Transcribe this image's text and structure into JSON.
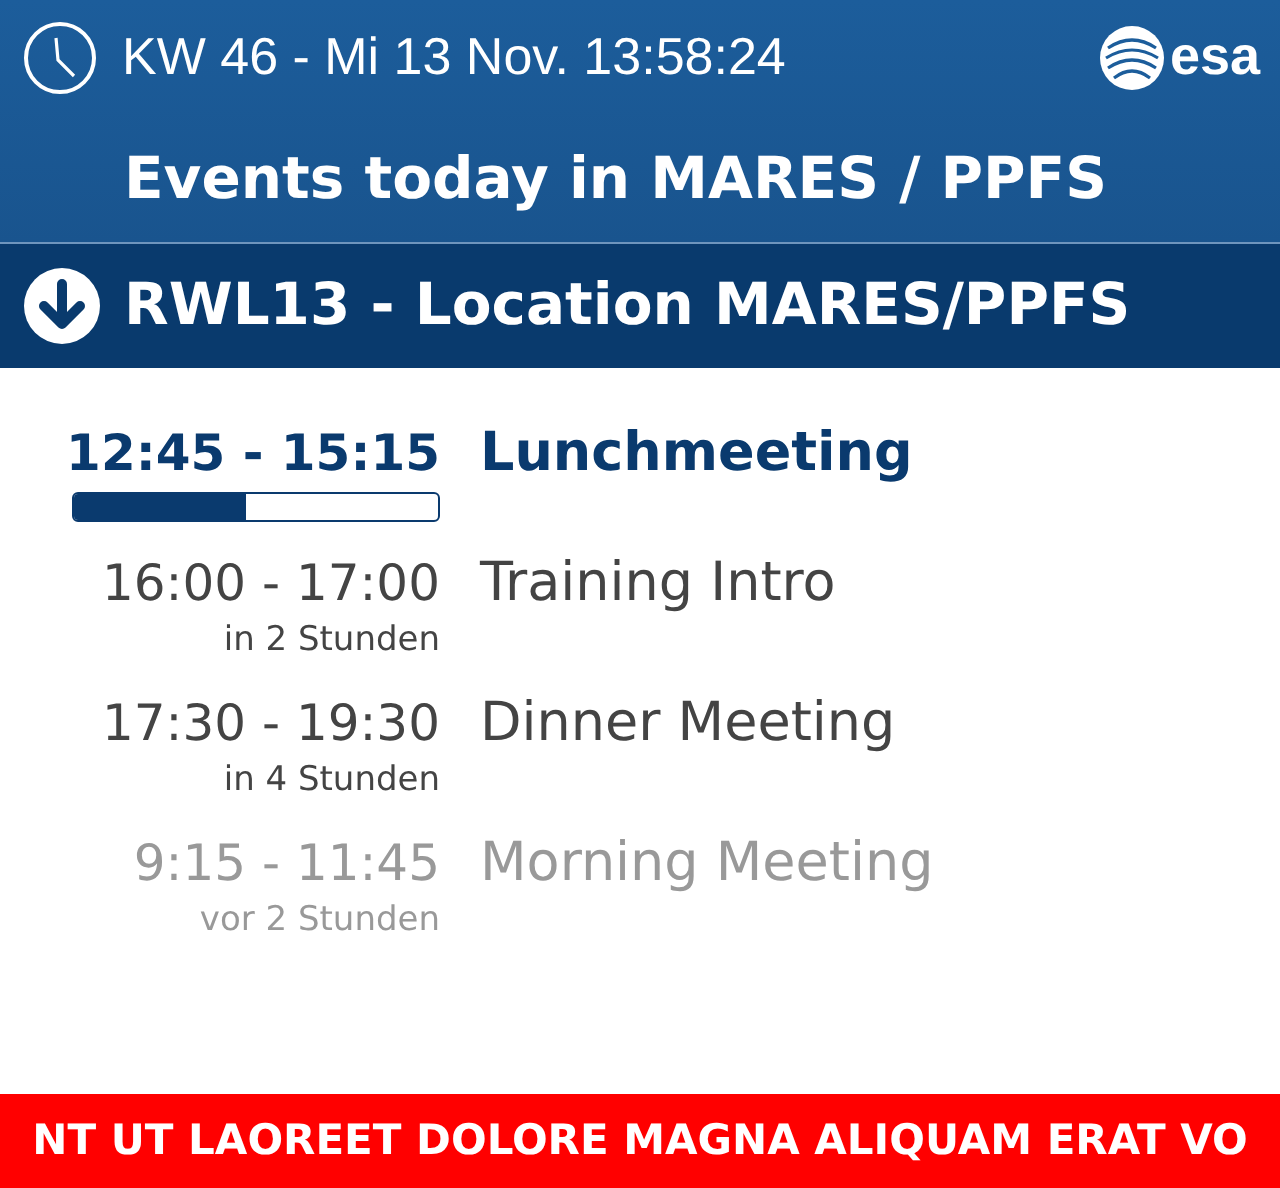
{
  "header": {
    "datetime": "KW 46 - Mi 13 Nov. 13:58:24",
    "logo_text": "esa",
    "title": "Events today in MARES / PPFS"
  },
  "location": {
    "label": "RWL13 - Location MARES/PPFS"
  },
  "events": [
    {
      "time": "12:45 - 15:15",
      "title": "Lunchmeeting",
      "kind": "current",
      "level": 0.47
    },
    {
      "time": "16:00 - 17:00",
      "title": "Training Intro",
      "kind": "upcoming",
      "relative": "in 2 Stunden"
    },
    {
      "time": "17:30 - 19:30",
      "title": "Dinner Meeting",
      "kind": "upcoming",
      "relative": "in 4 Stunden"
    },
    {
      "time": "9:15 - 11:45",
      "title": "Morning Meeting",
      "kind": "past",
      "relative": "vor 2 Stunden"
    }
  ],
  "ticker": {
    "text": "NT UT LAOREET DOLORE MAGNA ALIQUAM ERAT VO"
  }
}
